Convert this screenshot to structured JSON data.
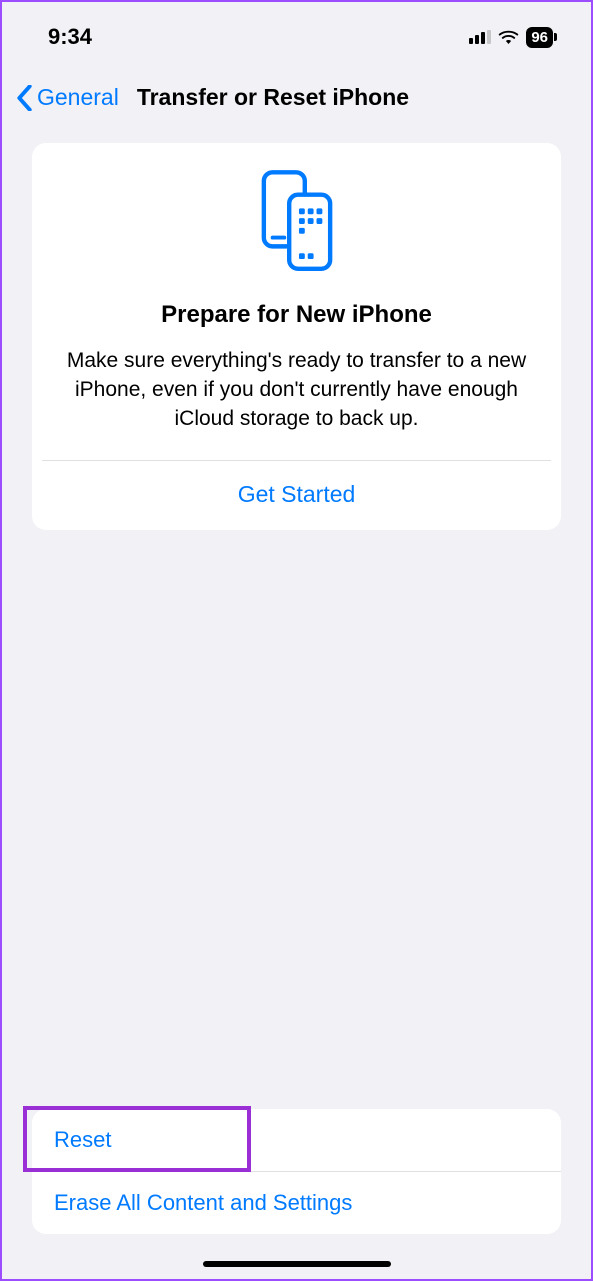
{
  "status": {
    "time": "9:34",
    "battery": "96"
  },
  "nav": {
    "back_label": "General",
    "title": "Transfer or Reset iPhone"
  },
  "card": {
    "title": "Prepare for New iPhone",
    "description": "Make sure everything's ready to transfer to a new iPhone, even if you don't currently have enough iCloud storage to back up.",
    "cta": "Get Started"
  },
  "list": {
    "reset": "Reset",
    "erase": "Erase All Content and Settings"
  },
  "colors": {
    "accent": "#007aff",
    "highlight_border": "#9b2fd6"
  }
}
